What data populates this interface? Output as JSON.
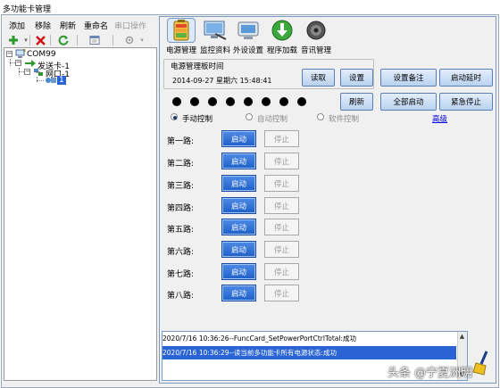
{
  "window": {
    "title": "多功能卡管理"
  },
  "menu": {
    "add": "添加",
    "remove": "移除",
    "refresh": "刷新",
    "rename": "重命名",
    "serial": "串口操作"
  },
  "toolbar": {
    "icons": [
      "add-icon",
      "delete-icon",
      "refresh-icon",
      "properties-icon",
      "serial-icon"
    ]
  },
  "tree": {
    "root": "COM99",
    "sender": "发送卡-1",
    "port": "网口-1",
    "card": "1"
  },
  "tabs": [
    {
      "label": "电源管理",
      "icon": "battery-icon",
      "selected": true
    },
    {
      "label": "监控资料",
      "icon": "monitor-icon"
    },
    {
      "label": "外设设置",
      "icon": "peripheral-icon"
    },
    {
      "label": "程序加载",
      "icon": "download-icon"
    },
    {
      "label": "音讯管理",
      "icon": "speaker-icon"
    }
  ],
  "board": {
    "group_label": "电源管理板时间",
    "time": "2014-09-27  星期六  15:48:41",
    "read": "读取",
    "set": "设置",
    "set_note": "设置备注",
    "start_delay": "启动延时",
    "refresh": "刷新",
    "start_all": "全部启动",
    "emergency_stop": "紧急停止"
  },
  "indicators": {
    "count": 8,
    "color": "#000000"
  },
  "control_mode": {
    "manual": "手动控制",
    "auto": "自动控制",
    "software": "软件控制",
    "selected": "manual"
  },
  "advanced_link": "高级",
  "routes": {
    "labels": [
      "第一路:",
      "第二路:",
      "第三路:",
      "第四路:",
      "第五路:",
      "第六路:",
      "第七路:",
      "第八路:"
    ],
    "start": "启动",
    "stop": "停止"
  },
  "log": {
    "lines": [
      "2020/7/16 10:36:26--FuncCard_SetPowerPortCtrlTotal:成功",
      "2020/7/16 10:36:29--读当前多功能卡所有电源状态:成功"
    ]
  },
  "watermark": "头条 @宁夏洲明",
  "colors": {
    "accent": "#2a63d4",
    "start_button": "#1e5fc9",
    "border": "#7a9ac0"
  }
}
